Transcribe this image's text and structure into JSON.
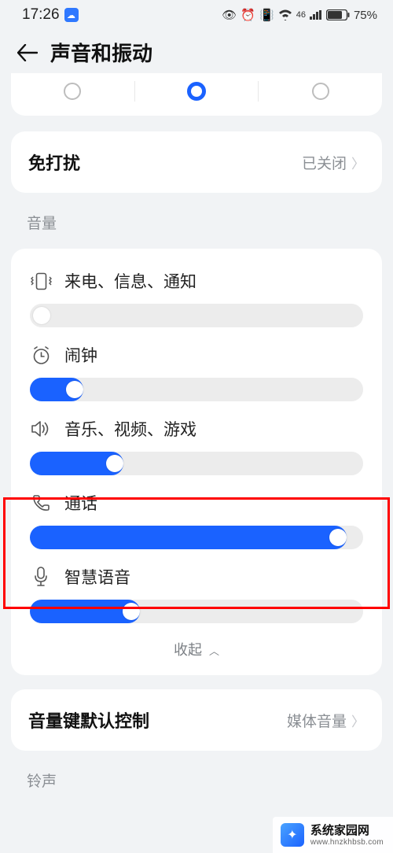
{
  "status": {
    "time": "17:26",
    "battery": "75%",
    "net": "46"
  },
  "header": {
    "title": "声音和振动"
  },
  "dnd": {
    "label": "免打扰",
    "value": "已关闭"
  },
  "section_volume": "音量",
  "vol": {
    "ring": {
      "name": "来电、信息、通知",
      "pct": 0
    },
    "alarm": {
      "name": "闹钟",
      "pct": 14
    },
    "media": {
      "name": "音乐、视频、游戏",
      "pct": 28
    },
    "call": {
      "name": "通话",
      "pct": 94
    },
    "voice": {
      "name": "智慧语音",
      "pct": 32
    }
  },
  "collapse": "收起",
  "volkey": {
    "label": "音量键默认控制",
    "value": "媒体音量"
  },
  "section_ring": "铃声",
  "watermark": {
    "name": "系统家园网",
    "url": "www.hnzkhbsb.com"
  }
}
